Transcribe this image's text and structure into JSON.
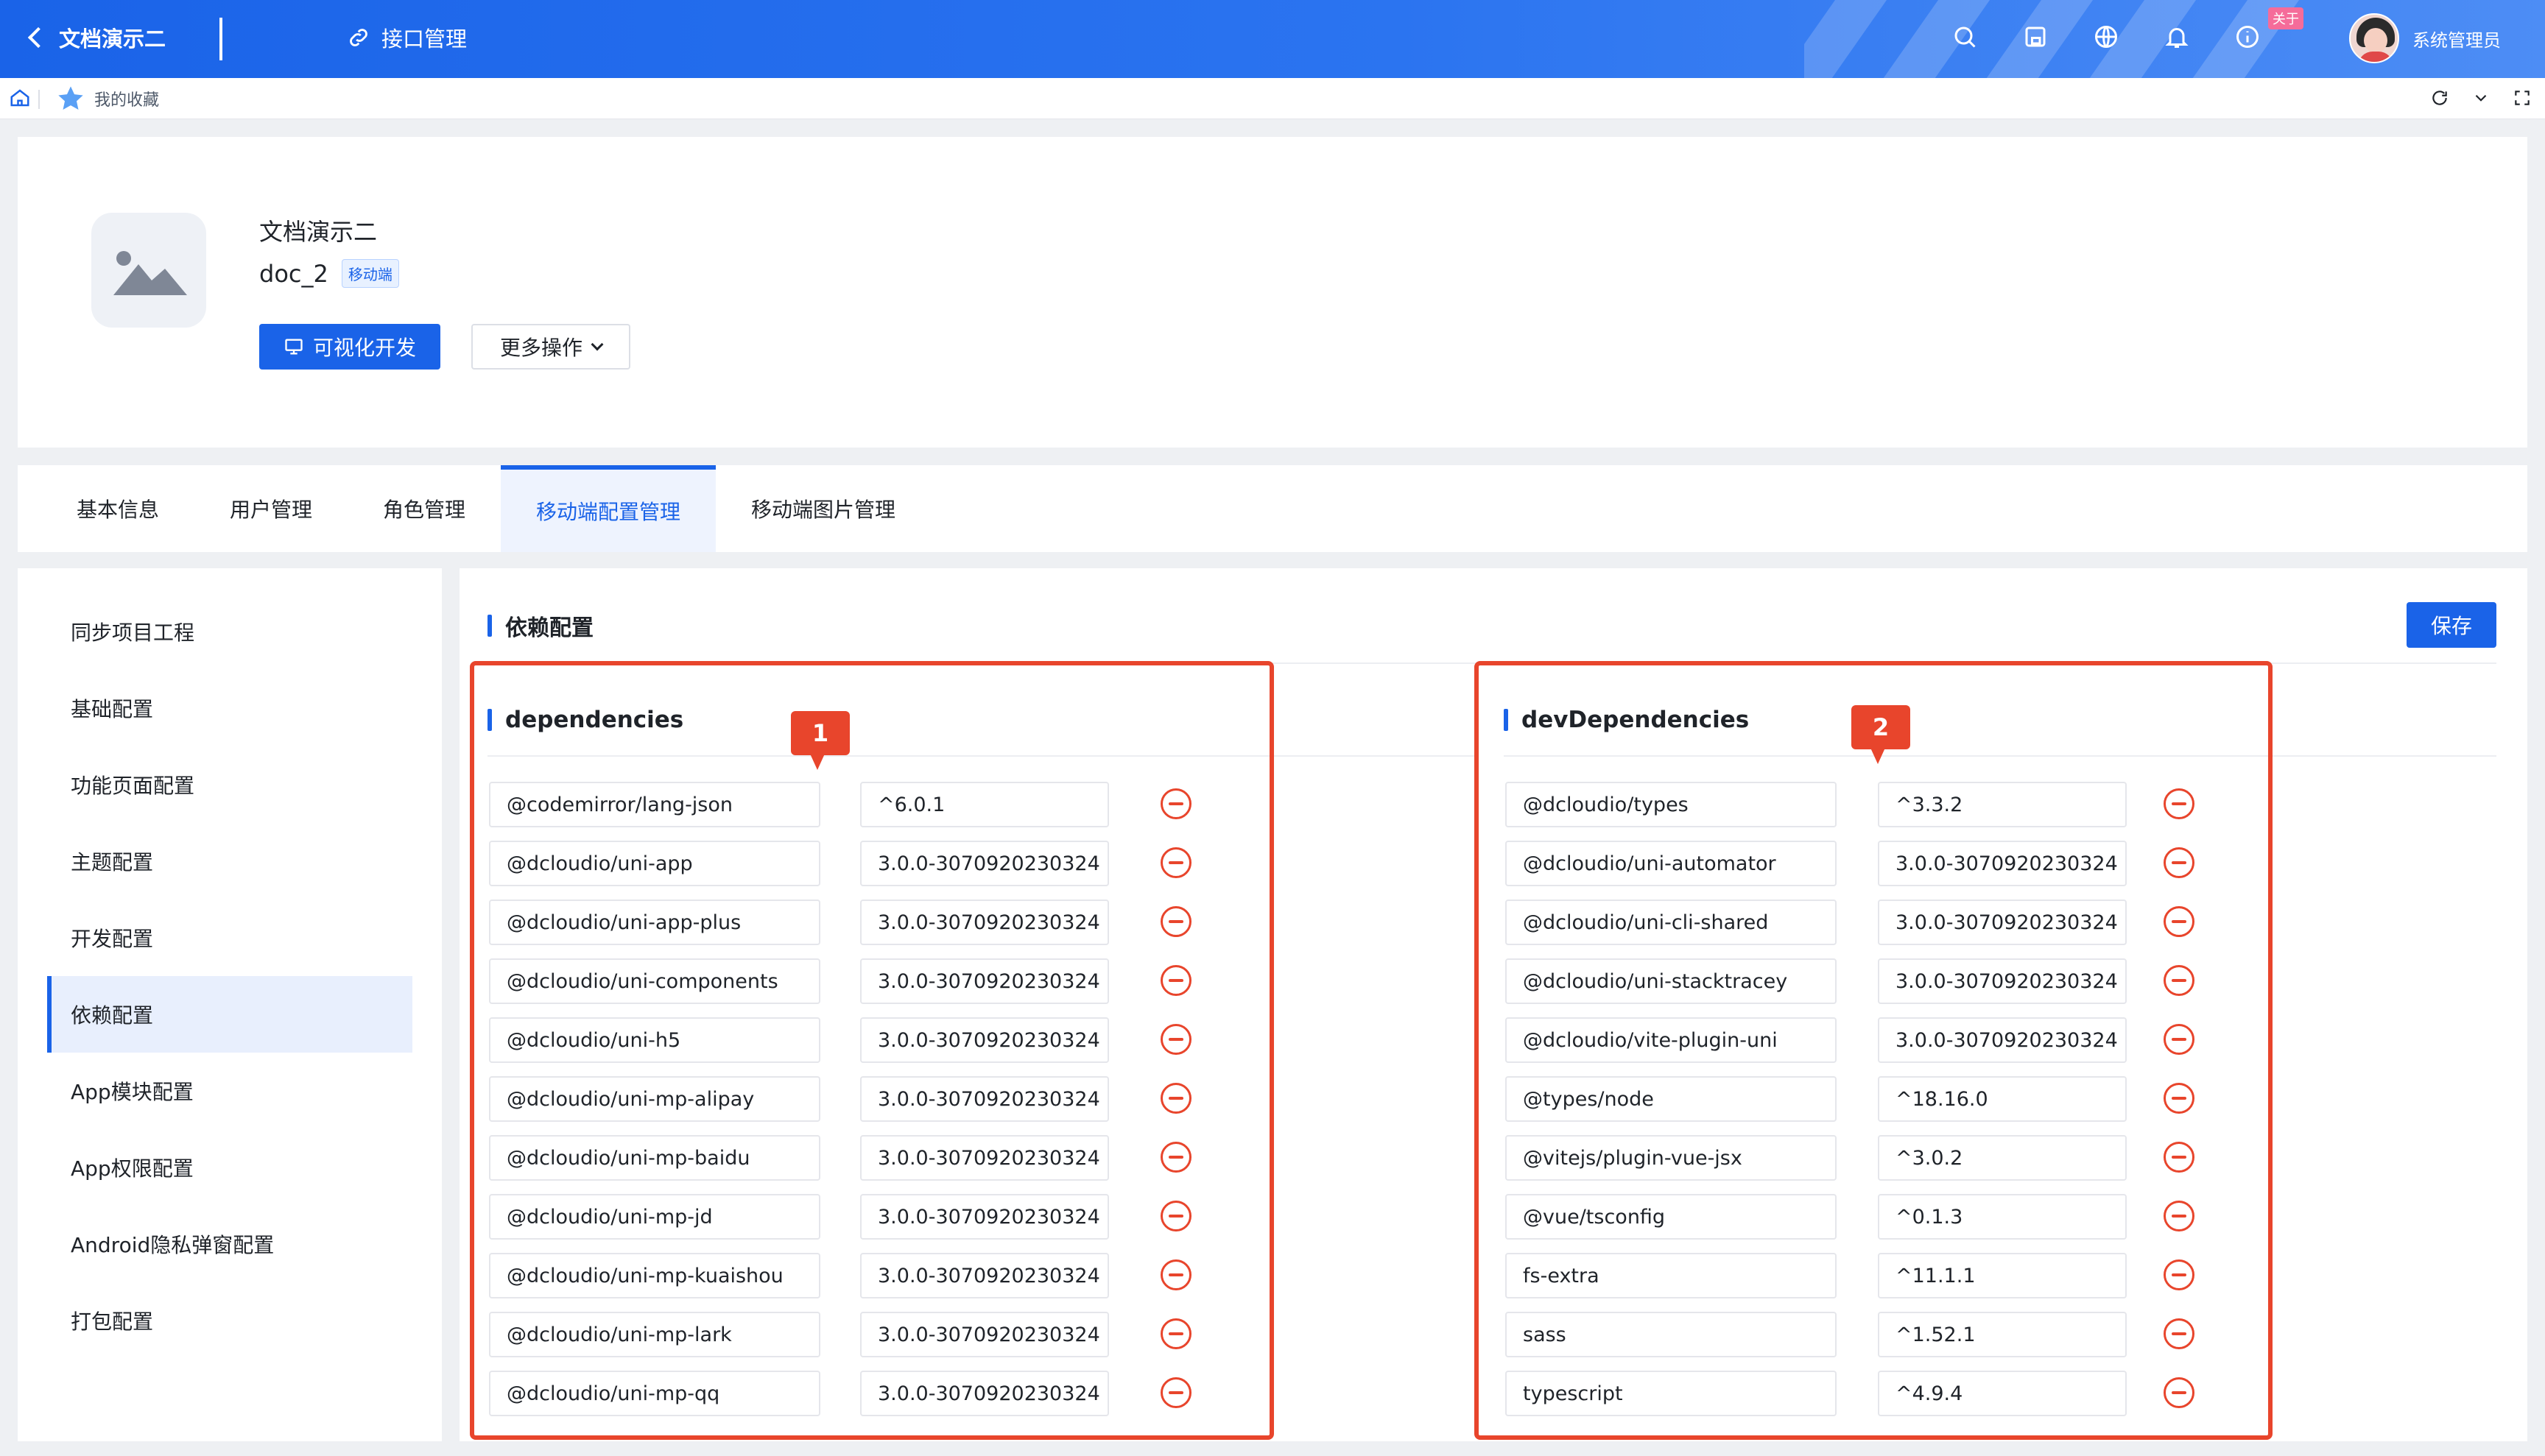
{
  "topbar": {
    "app_title": "文档演示二",
    "api_management": "接口管理",
    "badge": "关于",
    "username": "系统管理员"
  },
  "crumb": {
    "favorites": "我的收藏"
  },
  "project": {
    "name": "文档演示二",
    "code": "doc_2",
    "tag": "移动端",
    "visual_dev": "可视化开发",
    "more_actions": "更多操作"
  },
  "tabs": [
    "基本信息",
    "用户管理",
    "角色管理",
    "移动端配置管理",
    "移动端图片管理"
  ],
  "sidebar": [
    "同步项目工程",
    "基础配置",
    "功能页面配置",
    "主题配置",
    "开发配置",
    "依赖配置",
    "App模块配置",
    "App权限配置",
    "Android隐私弹窗配置",
    "打包配置"
  ],
  "main": {
    "title": "依赖配置",
    "save": "保存",
    "dependencies_title": "dependencies",
    "devdependencies_title": "devDependencies",
    "marker_1": "1",
    "marker_2": "2"
  },
  "dependencies": [
    {
      "name": "@codemirror/lang-json",
      "version": "^6.0.1"
    },
    {
      "name": "@dcloudio/uni-app",
      "version": "3.0.0-3070920230324"
    },
    {
      "name": "@dcloudio/uni-app-plus",
      "version": "3.0.0-3070920230324"
    },
    {
      "name": "@dcloudio/uni-components",
      "version": "3.0.0-3070920230324"
    },
    {
      "name": "@dcloudio/uni-h5",
      "version": "3.0.0-3070920230324"
    },
    {
      "name": "@dcloudio/uni-mp-alipay",
      "version": "3.0.0-3070920230324"
    },
    {
      "name": "@dcloudio/uni-mp-baidu",
      "version": "3.0.0-3070920230324"
    },
    {
      "name": "@dcloudio/uni-mp-jd",
      "version": "3.0.0-3070920230324"
    },
    {
      "name": "@dcloudio/uni-mp-kuaishou",
      "version": "3.0.0-3070920230324"
    },
    {
      "name": "@dcloudio/uni-mp-lark",
      "version": "3.0.0-3070920230324"
    },
    {
      "name": "@dcloudio/uni-mp-qq",
      "version": "3.0.0-3070920230324"
    }
  ],
  "devDependencies": [
    {
      "name": "@dcloudio/types",
      "version": "^3.3.2"
    },
    {
      "name": "@dcloudio/uni-automator",
      "version": "3.0.0-3070920230324"
    },
    {
      "name": "@dcloudio/uni-cli-shared",
      "version": "3.0.0-3070920230324"
    },
    {
      "name": "@dcloudio/uni-stacktracey",
      "version": "3.0.0-3070920230324"
    },
    {
      "name": "@dcloudio/vite-plugin-uni",
      "version": "3.0.0-3070920230324"
    },
    {
      "name": "@types/node",
      "version": "^18.16.0"
    },
    {
      "name": "@vitejs/plugin-vue-jsx",
      "version": "^3.0.2"
    },
    {
      "name": "@vue/tsconfig",
      "version": "^0.1.3"
    },
    {
      "name": "fs-extra",
      "version": "^11.1.1"
    },
    {
      "name": "sass",
      "version": "^1.52.1"
    },
    {
      "name": "typescript",
      "version": "^4.9.4"
    }
  ],
  "colors": {
    "primary": "#1a63e8",
    "danger": "#e8452c"
  },
  "icons": [
    "search-icon",
    "layout-icon",
    "globe-icon",
    "bell-icon",
    "info-icon",
    "home-icon",
    "star-icon",
    "refresh-icon",
    "chevron-down-icon",
    "fullscreen-icon"
  ]
}
